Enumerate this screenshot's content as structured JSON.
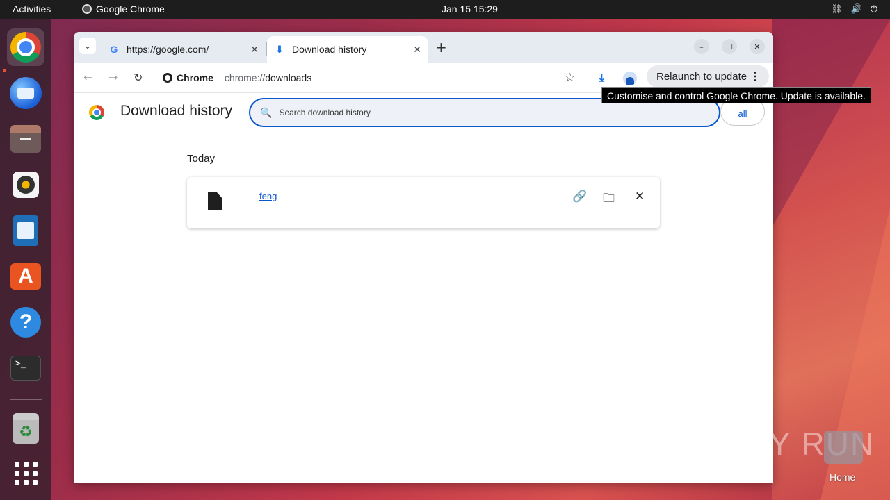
{
  "topbar": {
    "activities": "Activities",
    "app_name": "Google Chrome",
    "clock": "Jan 15  15:29",
    "tray_icons": [
      "network-icon",
      "volume-icon",
      "power-icon"
    ]
  },
  "dock": {
    "items": [
      "google-chrome",
      "thunderbird",
      "files",
      "rhythmbox",
      "libreoffice-writer",
      "app-center",
      "help",
      "terminal",
      "trash",
      "show-apps"
    ],
    "terminal_prompt": ">_"
  },
  "browser": {
    "tabs": [
      {
        "title": "https://google.com/",
        "favicon": "G"
      },
      {
        "title": "Download history",
        "favicon": "⬇"
      }
    ],
    "omnibox": {
      "chip_label": "Chrome",
      "url_scheme": "chrome://",
      "url_host": "downloads"
    },
    "relaunch_label": "Relaunch to update",
    "tooltip": "Customise and control Google Chrome. Update is available."
  },
  "downloads": {
    "title": "Download history",
    "search_placeholder": "Search download history",
    "clear_all": "Clear all",
    "sections": [
      {
        "date": "Today",
        "items": [
          {
            "file_name": "feng"
          }
        ]
      }
    ]
  },
  "desktop": {
    "watermark": "ANY RUN",
    "home_label": "Home"
  },
  "colors": {
    "accent": "#0b57d0",
    "topbar": "#1d1d1d",
    "ubuntu_orange": "#e95420"
  }
}
